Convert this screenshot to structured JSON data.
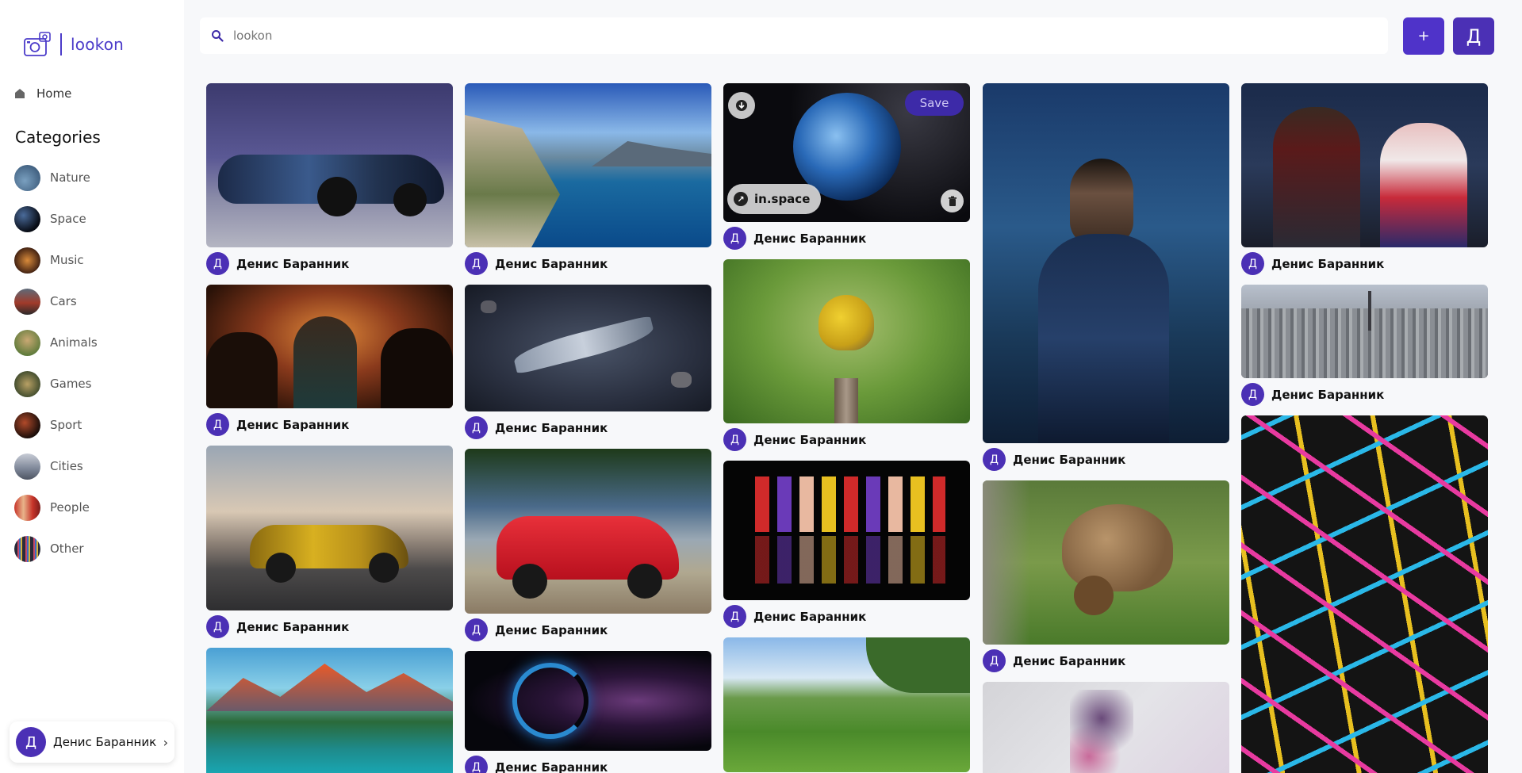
{
  "app": {
    "logo_text": "lookon"
  },
  "nav": {
    "home_label": "Home"
  },
  "categories": {
    "title": "Categories",
    "items": [
      {
        "label": "Nature"
      },
      {
        "label": "Space"
      },
      {
        "label": "Music"
      },
      {
        "label": "Cars"
      },
      {
        "label": "Animals"
      },
      {
        "label": "Games"
      },
      {
        "label": "Sport"
      },
      {
        "label": "Cities"
      },
      {
        "label": "People"
      },
      {
        "label": "Other"
      }
    ]
  },
  "search": {
    "placeholder": "lookon"
  },
  "header": {
    "add_label": "+",
    "profile_initial": "Д"
  },
  "user": {
    "initial": "Д",
    "name": "Денис Баранник",
    "chevron": "›"
  },
  "hover_card": {
    "save_label": "Save",
    "source_label": "in.space"
  },
  "colors": {
    "accent": "#4f33c9",
    "avatar": "#4b30b5",
    "background": "#f7f8fa",
    "sidebar": "#ffffff"
  },
  "pins": {
    "author_initial": "Д",
    "author_name": "Денис Баранник"
  }
}
